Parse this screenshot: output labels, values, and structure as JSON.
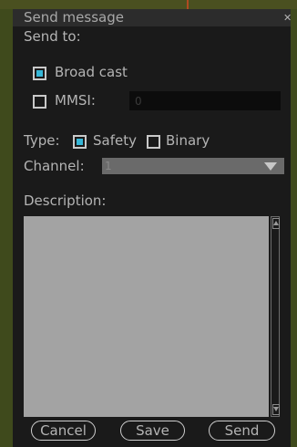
{
  "dialog": {
    "title": "Send message",
    "close_icon": "close-icon"
  },
  "send_to": {
    "label": "Send to:",
    "broadcast": {
      "label": "Broad cast",
      "checked": true
    },
    "mmsi": {
      "label": "MMSI:",
      "checked": false,
      "value": "0"
    }
  },
  "type": {
    "label": "Type:",
    "safety": {
      "label": "Safety",
      "checked": true
    },
    "binary": {
      "label": "Binary",
      "checked": false
    }
  },
  "channel": {
    "label": "Channel:",
    "value": "1",
    "icon": "dropdown-arrow-icon"
  },
  "description": {
    "label": "Description:",
    "value": ""
  },
  "buttons": {
    "cancel": "Cancel",
    "save": "Save",
    "send": "Send"
  },
  "colors": {
    "dialog_bg": "#1a1a1a",
    "text": "#b4b4b4",
    "check_accent": "#35b6d7",
    "textarea_bg": "#a3a3a3",
    "background": "#3f4a1c"
  }
}
